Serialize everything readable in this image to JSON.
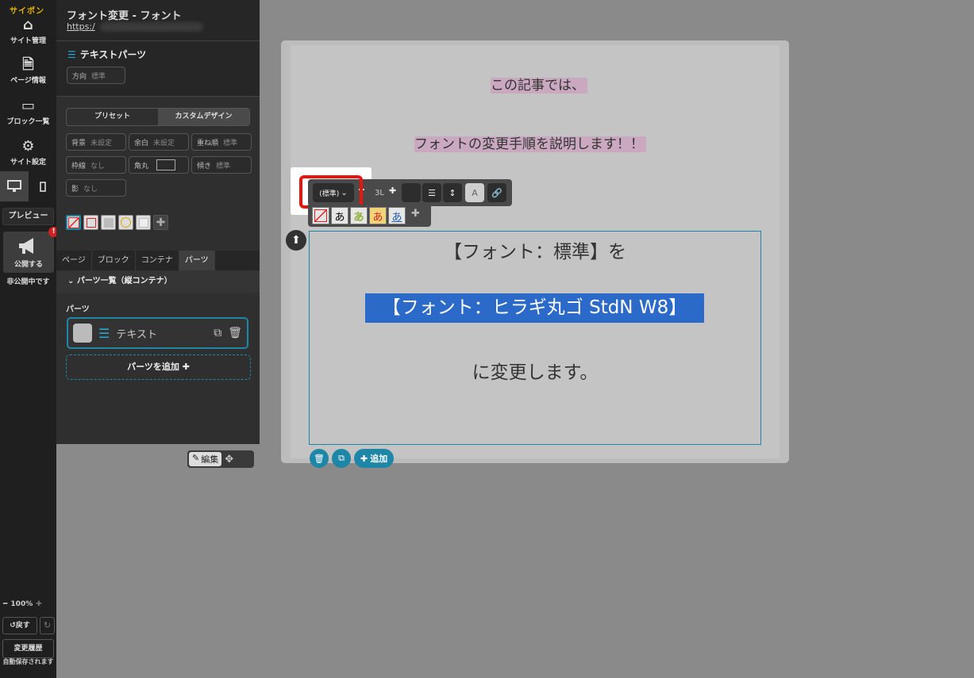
{
  "rail": {
    "logo": "サイポン",
    "site_manage": "サイト管理",
    "page_info": "ページ情報",
    "block_list": "ブロック一覧",
    "site_settings": "サイト設定",
    "preview": "プレビュー",
    "publish": "公開する",
    "badge": "!",
    "unpublished": "非公開中です",
    "zoom": "100%",
    "undo": "戻す",
    "history": "変更履歴",
    "autosave": "自動保存されます"
  },
  "panel": {
    "title": "フォント変更 - フォント",
    "url": "https:/",
    "part_title": "テキストパーツ",
    "direction_label": "方向",
    "direction_value": "標準",
    "preset": "プリセット",
    "custom_design": "カスタムデザイン",
    "props": [
      {
        "label": "背景",
        "value": "未設定"
      },
      {
        "label": "余白",
        "value": "未設定"
      },
      {
        "label": "重ね順",
        "value": "標準"
      },
      {
        "label": "枠線",
        "value": "なし"
      },
      {
        "label": "角丸",
        "value": ""
      },
      {
        "label": "傾き",
        "value": "標準"
      },
      {
        "label": "影",
        "value": "なし"
      }
    ],
    "tabs": [
      "ページ",
      "ブロック",
      "コンテナ",
      "パーツ"
    ],
    "active_tab": "パーツ",
    "list_header": "パーツ一覧（縦コンテナ）",
    "parts_label": "パーツ",
    "part_item": "テキスト",
    "add_part": "パーツを追加",
    "edit": "編集"
  },
  "canvas": {
    "line1": "この記事では、",
    "line2": "フォントの変更手順を説明します！！",
    "text1": "【フォント：標準】を",
    "text2": "【フォント：ヒラギ丸ゴ StdN W8】",
    "text3": "に変更します。",
    "add": "追加"
  },
  "toolbar": {
    "font_select": "(標準)",
    "size": "3L",
    "glyph": "あ",
    "color_btn": "A"
  },
  "colors": {
    "accent": "#1e86a6",
    "highlight": "#e8140e",
    "selection": "#2b6ac9"
  }
}
